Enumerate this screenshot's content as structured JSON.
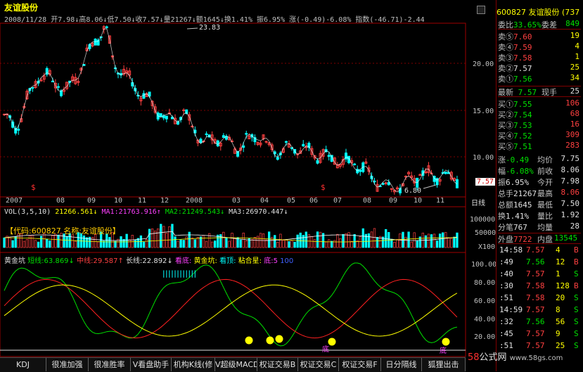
{
  "header": {
    "title": "友谊股份",
    "info": "2008/11/28  开7.98↓高8.06↓低7.50↓收7.57↓量21267↓额1645↓换1.41% 振6.95% 涨(-0.49)-6.08% 指数(-46.71)-2.44"
  },
  "price_axis": {
    "labels": [
      "20.00",
      "15.00",
      "10.00"
    ],
    "last": "7.57"
  },
  "annotations": {
    "high": "23.83",
    "low": "6.80"
  },
  "date_axis": {
    "labels": [
      "2007",
      "08",
      "09",
      "10",
      "11",
      "12",
      "2008",
      "03",
      "04",
      "05",
      "06",
      "07",
      "08",
      "09",
      "10",
      "11"
    ],
    "period": "日线"
  },
  "vol_panel": {
    "label": "VOL(3,5,10)",
    "v1": "21266.561↓",
    "ma1": "MA1:21763.916↑",
    "ma2": "MA2:21249.543↓",
    "ma3": "MA3:26970.447↓",
    "watermark": "【代码:600827 名称:友谊股份】",
    "ticks": [
      "100000",
      "50000",
      "X100"
    ]
  },
  "ind_panel": {
    "name": "黄金坑",
    "short": "短线:63.869↓",
    "mid": "中线:29.587↑",
    "long": "长线:22.892↓",
    "see_bottom": "看底:",
    "name2": "黄金坑:",
    "see_top": "看顶:",
    "sticky": "粘合星:",
    "bottom": "底:5",
    "hundred": "100",
    "ticks": [
      "100.00",
      "80.00",
      "60.00",
      "40.00",
      "20.00"
    ],
    "markers": [
      "底",
      "底"
    ]
  },
  "side": {
    "code": "600827",
    "name": "友谊股份",
    "extra": "(737",
    "weibi": {
      "label": "委比",
      "value": "33.65%",
      "ch_label": "委差",
      "ch_value": "849"
    },
    "sells": [
      {
        "label": "卖⑤",
        "price": "7.60",
        "vol": "19"
      },
      {
        "label": "卖④",
        "price": "7.59",
        "vol": "4"
      },
      {
        "label": "卖③",
        "price": "7.58",
        "vol": "1"
      },
      {
        "label": "卖②",
        "price": "7.57",
        "vol": "25"
      },
      {
        "label": "卖①",
        "price": "7.56",
        "vol": "34"
      }
    ],
    "latest": {
      "label": "最新",
      "price": "7.57",
      "lbl2": "现手",
      "val2": "25"
    },
    "buys": [
      {
        "label": "买①",
        "price": "7.55",
        "vol": "106"
      },
      {
        "label": "买②",
        "price": "7.54",
        "vol": "68"
      },
      {
        "label": "买③",
        "price": "7.53",
        "vol": "16"
      },
      {
        "label": "买④",
        "price": "7.52",
        "vol": "309"
      },
      {
        "label": "买⑤",
        "price": "7.51",
        "vol": "283"
      }
    ],
    "stats": [
      {
        "l1": "涨",
        "v1": "-0.49",
        "l2": "均价",
        "v2": "7.75"
      },
      {
        "l1": "幅",
        "v1": "-6.08%",
        "l2": "前收",
        "v2": "8.06"
      },
      {
        "l1": "振",
        "v1": "6.95%",
        "l2": "今开",
        "v2": "7.98"
      },
      {
        "l1": "总手",
        "v1": "21267",
        "l2": "最高",
        "v2": "8.06"
      },
      {
        "l1": "总额",
        "v1": "1645",
        "l2": "最低",
        "v2": "7.50"
      },
      {
        "l1": "换",
        "v1": "1.41%",
        "l2": "量比",
        "v2": "1.92"
      },
      {
        "l1": "分笔",
        "v1": "767",
        "l2": "均量",
        "v2": "28"
      }
    ],
    "outer": {
      "l1": "外盘",
      "v1": "7722",
      "l2": "内盘",
      "v2": "13545"
    },
    "ticks": [
      {
        "time": "14:58",
        "price": "7.57",
        "vol": "4",
        "dir": "B"
      },
      {
        "time": ":49",
        "price": "7.56",
        "vol": "12",
        "dir": "B"
      },
      {
        "time": ":40",
        "price": "7.57",
        "vol": "1",
        "dir": "S"
      },
      {
        "time": ":30",
        "price": "7.58",
        "vol": "128",
        "dir": "B"
      },
      {
        "time": ":51",
        "price": "7.58",
        "vol": "20",
        "dir": "S"
      },
      {
        "time": "14:59",
        "price": "7.57",
        "vol": "8",
        "dir": "S"
      },
      {
        "time": ":32",
        "price": "7.56",
        "vol": "56",
        "dir": "S"
      },
      {
        "time": ":45",
        "price": "7.57",
        "vol": "9",
        "dir": "S"
      },
      {
        "time": ":51",
        "price": "7.57",
        "vol": "25",
        "dir": "S"
      }
    ]
  },
  "tabs": [
    "KDJ",
    "很准加强",
    "很准胜率",
    "V看盘助手",
    "机构K线(修",
    "V超级MACD(",
    "权证交易B",
    "权证交易C",
    "权证交易F",
    "日分隔线",
    "狐狸出击"
  ],
  "watermark": {
    "num": "58",
    "text": "公式网",
    "url": "www.58gs.com"
  },
  "colors": {
    "up": "#ff4040",
    "down": "#00ffff",
    "ma_white": "#ffffff",
    "ma_yellow": "#ffff00",
    "ma_magenta": "#ff40ff",
    "ma_green": "#00e000",
    "border": "#a00000"
  }
}
